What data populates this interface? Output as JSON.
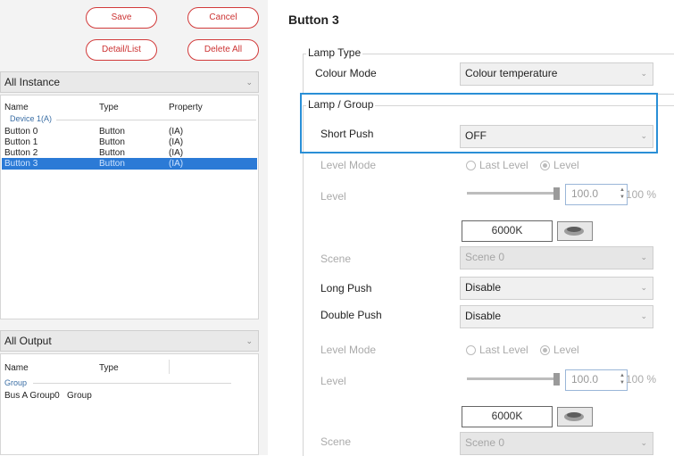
{
  "toolbar": {
    "save_label": "Save",
    "cancel_label": "Cancel",
    "detail_list_label": "Detail/List",
    "delete_all_label": "Delete All"
  },
  "instance_filter": {
    "value": "All Instance"
  },
  "instance_list": {
    "headers": [
      "Name",
      "Type",
      "Property"
    ],
    "group_label": "Device 1(A)",
    "rows": [
      {
        "name": "Button 0",
        "type": "Button",
        "property": "(IA)"
      },
      {
        "name": "Button 1",
        "type": "Button",
        "property": "(IA)"
      },
      {
        "name": "Button 2",
        "type": "Button",
        "property": "(IA)"
      },
      {
        "name": "Button 3",
        "type": "Button",
        "property": "(IA)",
        "selected": true
      }
    ]
  },
  "output_filter": {
    "value": "All Output"
  },
  "output_list": {
    "headers": [
      "Name",
      "Type"
    ],
    "group_label": "Group",
    "rows": [
      {
        "name": "Bus A Group0",
        "type": "Group"
      }
    ]
  },
  "detail": {
    "title": "Button 3",
    "lamp_type": {
      "legend": "Lamp Type",
      "colour_mode_label": "Colour Mode",
      "colour_mode_value": "Colour temperature"
    },
    "lamp_group": {
      "legend": "Lamp / Group",
      "short_push_label": "Short Push",
      "short_push_value": "OFF",
      "level_mode_label": "Level Mode",
      "last_level_label": "Last Level",
      "level_option_label": "Level",
      "level_label": "Level",
      "level_value": "100.0",
      "level_percent": "100 %",
      "colour_temp": "6000K",
      "scene_label": "Scene",
      "scene_value": "Scene 0",
      "long_push_label": "Long Push",
      "long_push_value": "Disable",
      "double_push_label": "Double Push",
      "double_push_value": "Disable",
      "level_mode2_label": "Level Mode",
      "last_level2_label": "Last Level",
      "level_option2_label": "Level",
      "level2_label": "Level",
      "level2_value": "100.0",
      "level2_percent": "100 %",
      "colour_temp2": "6000K",
      "scene2_label": "Scene",
      "scene2_value": "Scene 0"
    }
  },
  "colors": {
    "highlight_border": "#2a8fd6",
    "selection": "#2b7ad6",
    "button_border": "#d23a3a"
  }
}
